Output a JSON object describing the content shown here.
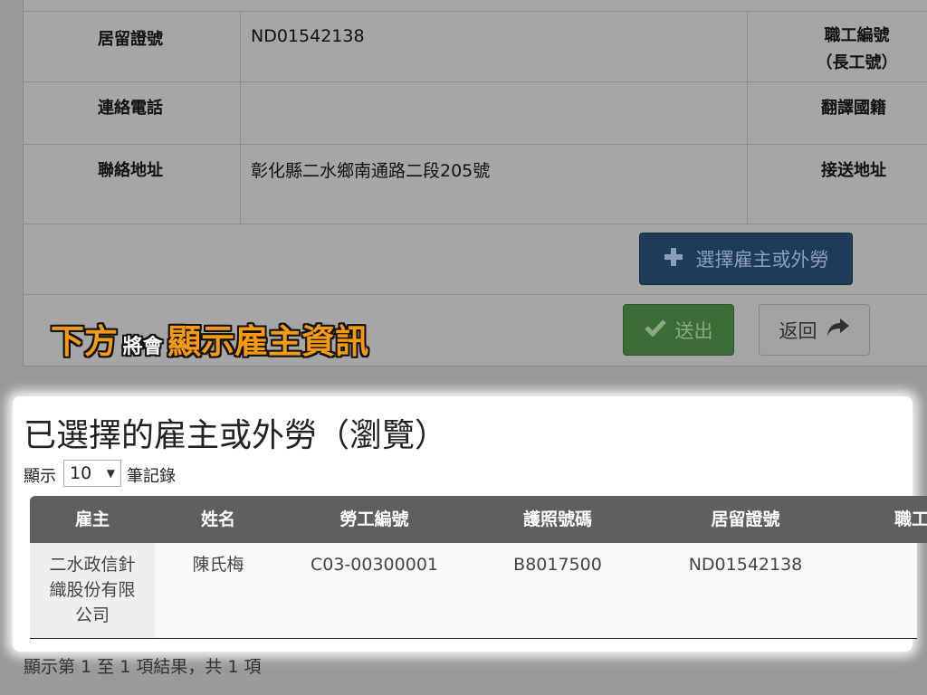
{
  "form": {
    "rows": [
      {
        "label": "居留證號",
        "value": "ND01542138",
        "right_label_line1": "職工編號",
        "right_label_line2": "（長工號）"
      },
      {
        "label": "連絡電話",
        "value": "",
        "right_label": "翻譯國籍"
      },
      {
        "label": "聯絡地址",
        "value": "彰化縣二水鄉南通路二段205號",
        "right_label": "接送地址"
      }
    ],
    "select_button": "選擇雇主或外勞",
    "submit_button": "送出",
    "back_button": "返回"
  },
  "caption": {
    "part1": "下方",
    "part2": "將會",
    "part3": "顯示雇主資訊"
  },
  "panel": {
    "title": "已選擇的雇主或外勞（瀏覽）",
    "length_prefix": "顯示",
    "length_value": "10",
    "length_suffix": "筆記錄",
    "columns": [
      "雇主",
      "姓名",
      "勞工編號",
      "護照號碼",
      "居留證號",
      "職工"
    ],
    "rows": [
      {
        "employer_line1": "二水政信針",
        "employer_line2": "織股份有限",
        "employer_line3": "公司",
        "name": "陳氏梅",
        "worker_id": "C03-00300001",
        "passport": "B8017500",
        "residence_id": "ND01542138"
      }
    ],
    "info": "顯示第 1 至 1 項結果，共 1 項"
  },
  "colors": {
    "overlay": "#9a9a9a",
    "primary_button": "#1e3c5a",
    "success_button": "#3b6b36",
    "caption_text": "#f59a12",
    "table_header": "#5f5f5f"
  },
  "icons": [
    "plus-icon",
    "check-icon",
    "share-arrow-icon"
  ]
}
